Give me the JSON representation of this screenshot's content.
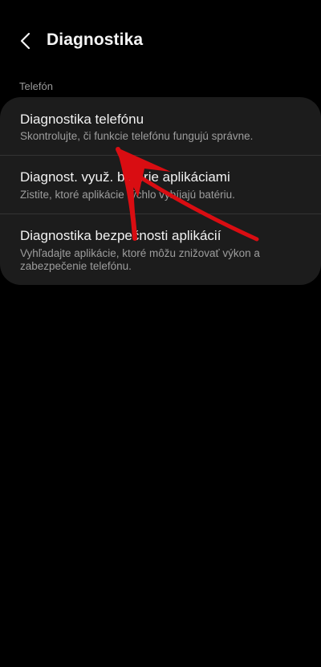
{
  "header": {
    "back_icon": "chevron-left-icon",
    "title": "Diagnostika"
  },
  "section": {
    "label": "Telefón"
  },
  "items": [
    {
      "title": "Diagnostika telefónu",
      "subtitle": "Skontrolujte, či funkcie telefónu fungujú správne."
    },
    {
      "title": "Diagnost. využ. batérie aplikáciami",
      "subtitle": "Zistite, ktoré aplikácie rýchlo vybíjajú batériu."
    },
    {
      "title": "Diagnostika bezpečnosti aplikácií",
      "subtitle": "Vyhľadajte aplikácie, ktoré môžu znižovať výkon a zabezpečenie telefónu."
    }
  ],
  "colors": {
    "background": "#000000",
    "card": "#1c1c1c",
    "annotation_arrow": "#d90d12"
  }
}
